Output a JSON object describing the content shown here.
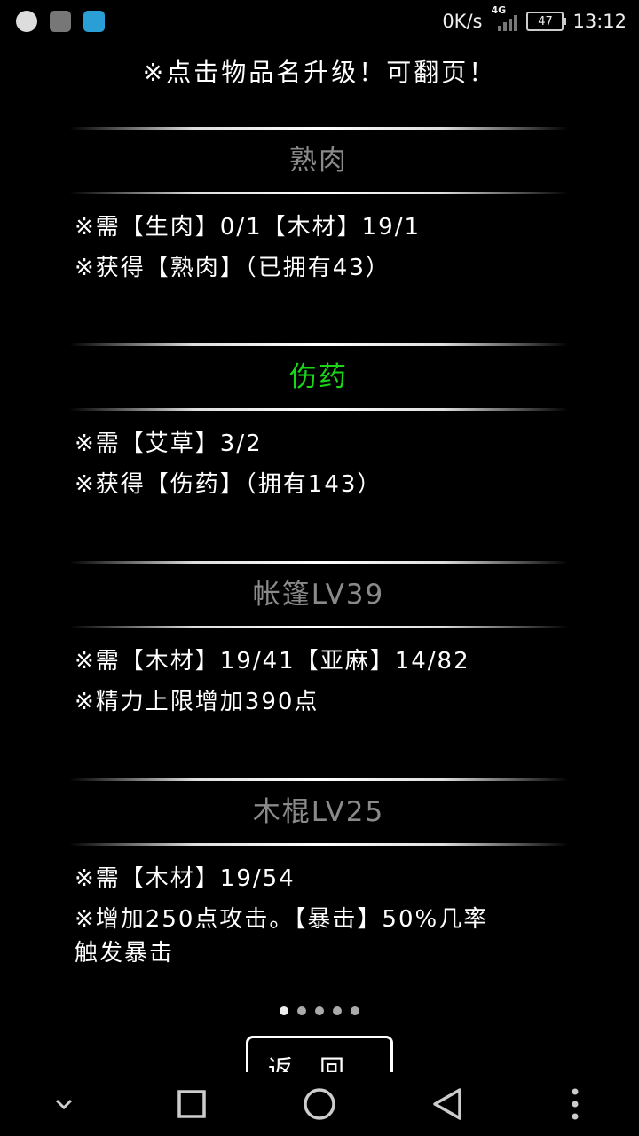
{
  "status": {
    "speed": "0K/s",
    "network": "4G",
    "battery": "47",
    "time": "13:12"
  },
  "hint": "※点击物品名升级！可翻页！",
  "cards": [
    {
      "title": "熟肉",
      "title_color": "#8a8a8a",
      "lines": [
        "※需【生肉】0/1【木材】19/1",
        "※获得【熟肉】（已拥有43）"
      ]
    },
    {
      "title": "伤药",
      "title_color": "#19d619",
      "lines": [
        "※需【艾草】3/2",
        "※获得【伤药】（拥有143）"
      ]
    },
    {
      "title": "帐篷LV39",
      "title_color": "#8a8a8a",
      "lines": [
        "※需【木材】19/41【亚麻】14/82",
        "※精力上限增加390点"
      ]
    },
    {
      "title": "木棍LV25",
      "title_color": "#8a8a8a",
      "lines": [
        "※需【木材】19/54",
        "※增加250点攻击。【暴击】50%几率",
        "触发暴击"
      ]
    }
  ],
  "pager": {
    "pages": 5,
    "current": 1
  },
  "back_label": "返回",
  "icons": {
    "nav_collapse": "chevron-down-icon",
    "nav_recent": "square-icon",
    "nav_home": "circle-icon",
    "nav_back": "triangle-back-icon",
    "nav_menu": "more-vertical-icon"
  }
}
